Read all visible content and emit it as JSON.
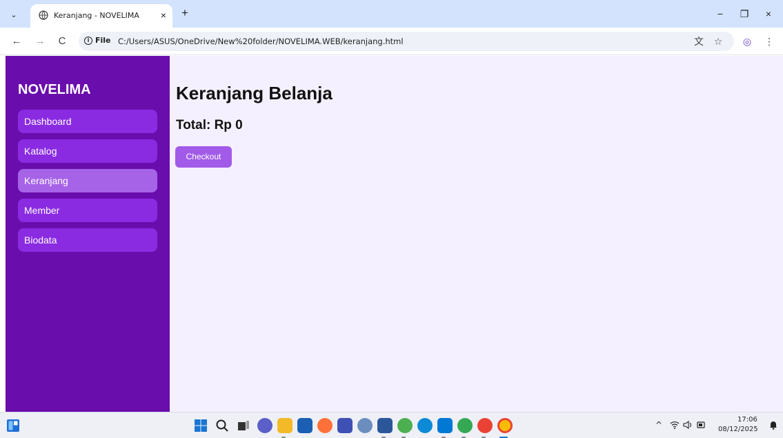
{
  "browser": {
    "tab_title": "Keranjang - NOVELIMA",
    "tab_close": "×",
    "new_tab": "+",
    "site_info_label": "File",
    "url": "C:/Users/ASUS/OneDrive/New%20folder/NOVELIMA.WEB/keranjang.html",
    "window_controls": {
      "minimize": "−",
      "restore": "❐",
      "close": "×"
    },
    "nav": {
      "back": "←",
      "forward": "→",
      "reload": "C"
    },
    "toolbar_icons": {
      "translate": "文",
      "bookmark": "☆",
      "profile": "◎",
      "menu": "⋮"
    }
  },
  "sidebar": {
    "brand": "NOVELIMA",
    "items": [
      {
        "label": "Dashboard",
        "active": false
      },
      {
        "label": "Katalog",
        "active": false
      },
      {
        "label": "Keranjang",
        "active": true
      },
      {
        "label": "Member",
        "active": false
      },
      {
        "label": "Biodata",
        "active": false
      }
    ]
  },
  "main": {
    "title": "Keranjang Belanja",
    "total": "Total: Rp 0",
    "checkout_label": "Checkout"
  },
  "taskbar": {
    "time": "17:06",
    "date": "08/12/2025",
    "tray_chevron": "^"
  },
  "colors": {
    "sidebar_bg": "#6a0dad",
    "nav_item_bg": "#8a2be2",
    "nav_item_active_bg": "#a663e8",
    "page_bg": "#f5f0ff",
    "button_bg": "#a25be8"
  }
}
